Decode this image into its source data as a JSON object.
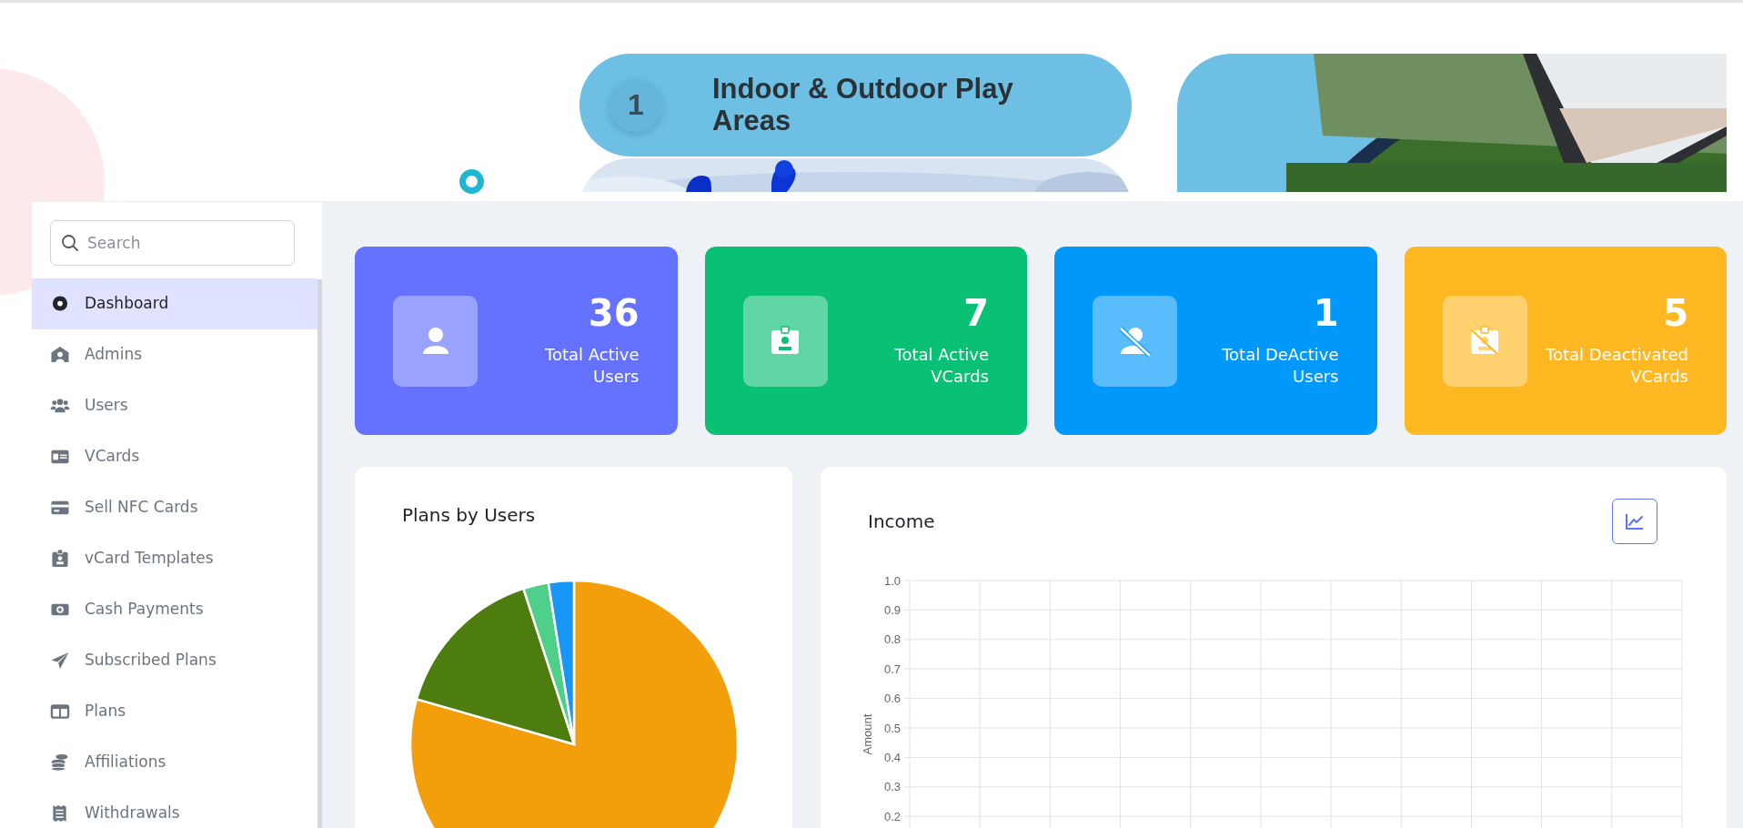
{
  "banner": {
    "step_number": "1",
    "step_title": "Indoor & Outdoor Play Areas"
  },
  "sidebar": {
    "search": {
      "placeholder": "Search"
    },
    "items": [
      {
        "label": "Dashboard",
        "kind": "dashboard",
        "selected": true
      },
      {
        "label": "Admins",
        "kind": "admins",
        "selected": false
      },
      {
        "label": "Users",
        "kind": "users",
        "selected": false
      },
      {
        "label": "VCards",
        "kind": "vcards",
        "selected": false
      },
      {
        "label": "Sell NFC Cards",
        "kind": "card",
        "selected": false
      },
      {
        "label": "vCard Templates",
        "kind": "templates",
        "selected": false
      },
      {
        "label": "Cash Payments",
        "kind": "cash",
        "selected": false
      },
      {
        "label": "Subscribed Plans",
        "kind": "plane",
        "selected": false
      },
      {
        "label": "Plans",
        "kind": "plans",
        "selected": false
      },
      {
        "label": "Affiliations",
        "kind": "coins",
        "selected": false
      },
      {
        "label": "Withdrawals",
        "kind": "receipt",
        "selected": false
      }
    ]
  },
  "stats": [
    {
      "value": "36",
      "label": "Total Active Users",
      "kind": "user",
      "color": "#6571ff"
    },
    {
      "value": "7",
      "label": "Total Active VCards",
      "kind": "badge",
      "color": "#0ac074"
    },
    {
      "value": "1",
      "label": "Total DeActive Users",
      "kind": "user-slash",
      "color": "#0099fb"
    },
    {
      "value": "5",
      "label": "Total Deactivated VCards",
      "kind": "badge-slash",
      "color": "#ffb821"
    }
  ],
  "plans_card": {
    "title": "Plans by Users"
  },
  "income_card": {
    "title": "Income",
    "chart_data": {
      "type": "line",
      "grid": true,
      "categories": [
        null,
        null,
        null,
        null,
        null,
        null,
        null,
        null,
        null,
        null,
        null,
        null
      ],
      "ylabel": "Amount",
      "ylim": [
        0.2,
        1.0
      ],
      "yticks": [
        {
          "value": 1.0,
          "label": "1.0"
        },
        {
          "value": 0.9,
          "label": "0.9"
        },
        {
          "value": 0.8,
          "label": "0.8"
        },
        {
          "value": 0.7,
          "label": "0.7"
        },
        {
          "value": 0.6,
          "label": "0.6"
        },
        {
          "value": 0.5,
          "label": "0.5"
        },
        {
          "value": 0.4,
          "label": "0.4"
        },
        {
          "value": 0.3,
          "label": "0.3"
        },
        {
          "value": 0.2,
          "label": "0.2"
        }
      ]
    }
  }
}
